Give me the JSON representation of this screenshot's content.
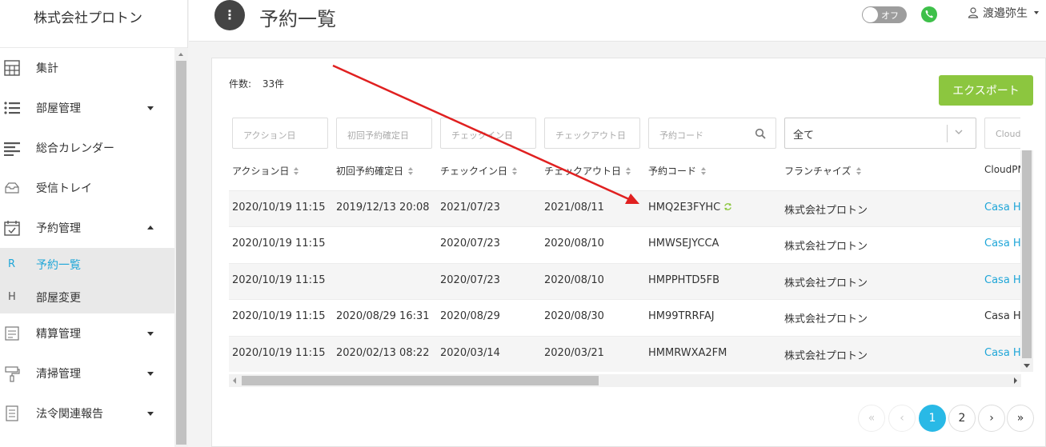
{
  "sidebar": {
    "brand": "株式会社プロトン",
    "items": [
      {
        "label": "集計",
        "icon": "calculator-icon"
      },
      {
        "label": "部屋管理",
        "icon": "list-icon",
        "caret": "down"
      },
      {
        "label": "総合カレンダー",
        "icon": "align-left-icon"
      },
      {
        "label": "受信トレイ",
        "icon": "inbox-icon"
      },
      {
        "label": "予約管理",
        "icon": "calendar-check-icon",
        "caret": "up"
      }
    ],
    "sub_items": [
      {
        "key": "R",
        "label": "予約一覧",
        "active": true
      },
      {
        "key": "H",
        "label": "部屋変更",
        "active": false
      }
    ],
    "items_after": [
      {
        "label": "精算管理",
        "icon": "receipt-icon",
        "caret": "down"
      },
      {
        "label": "清掃管理",
        "icon": "paint-roller-icon",
        "caret": "down"
      },
      {
        "label": "法令関連報告",
        "icon": "document-icon",
        "caret": "down"
      }
    ]
  },
  "header": {
    "menu_button": "⋮",
    "title": "予約一覧",
    "toggle_label": "オフ",
    "user_name": "渡邉弥生"
  },
  "main": {
    "count_label": "件数:",
    "count_value": "33件",
    "export_label": "エクスポート",
    "filters": {
      "action_date": "アクション日",
      "first_confirm_date": "初回予約確定日",
      "checkin": "チェックイン日",
      "checkout": "チェックアウト日",
      "reservation_code": "予約コード",
      "franchise_selected": "全て",
      "cloudpms": "Cloudb"
    },
    "columns": [
      "アクション日",
      "初回予約確定日",
      "チェックイン日",
      "チェックアウト日",
      "予約コード",
      "フランチャイズ",
      "CloudPM"
    ],
    "rows": [
      {
        "action": "2020/10/19 11:15",
        "first": "2019/12/13 20:08",
        "checkin": "2021/07/23",
        "checkout": "2021/08/11",
        "code": "HMQ2E3FYHC",
        "franchise": "株式会社プロトン",
        "cloud": "Casa H",
        "cloud_link": true,
        "sync": true
      },
      {
        "action": "2020/10/19 11:15",
        "first": "",
        "checkin": "2020/07/23",
        "checkout": "2020/08/10",
        "code": "HMWSEJYCCA",
        "franchise": "株式会社プロトン",
        "cloud": "Casa H",
        "cloud_link": true,
        "sync": false
      },
      {
        "action": "2020/10/19 11:15",
        "first": "",
        "checkin": "2020/07/23",
        "checkout": "2020/08/10",
        "code": "HMPPHTD5FB",
        "franchise": "株式会社プロトン",
        "cloud": "Casa H",
        "cloud_link": true,
        "sync": false
      },
      {
        "action": "2020/10/19 11:15",
        "first": "2020/08/29 16:31",
        "checkin": "2020/08/29",
        "checkout": "2020/08/30",
        "code": "HM99TRRFAJ",
        "franchise": "株式会社プロトン",
        "cloud": "Casa H",
        "cloud_link": false,
        "sync": false
      },
      {
        "action": "2020/10/19 11:15",
        "first": "2020/02/13 08:22",
        "checkin": "2020/03/14",
        "checkout": "2020/03/21",
        "code": "HMMRWXA2FM",
        "franchise": "株式会社プロトン",
        "cloud": "Casa H",
        "cloud_link": true,
        "sync": false
      }
    ],
    "pagination": [
      "«",
      "‹",
      "1",
      "2",
      "›",
      "»"
    ],
    "current_page": "1"
  },
  "colors": {
    "accent": "#29b9e6",
    "export": "#8cc63f",
    "arrow": "#e02020",
    "link": "#1fa6d8"
  }
}
